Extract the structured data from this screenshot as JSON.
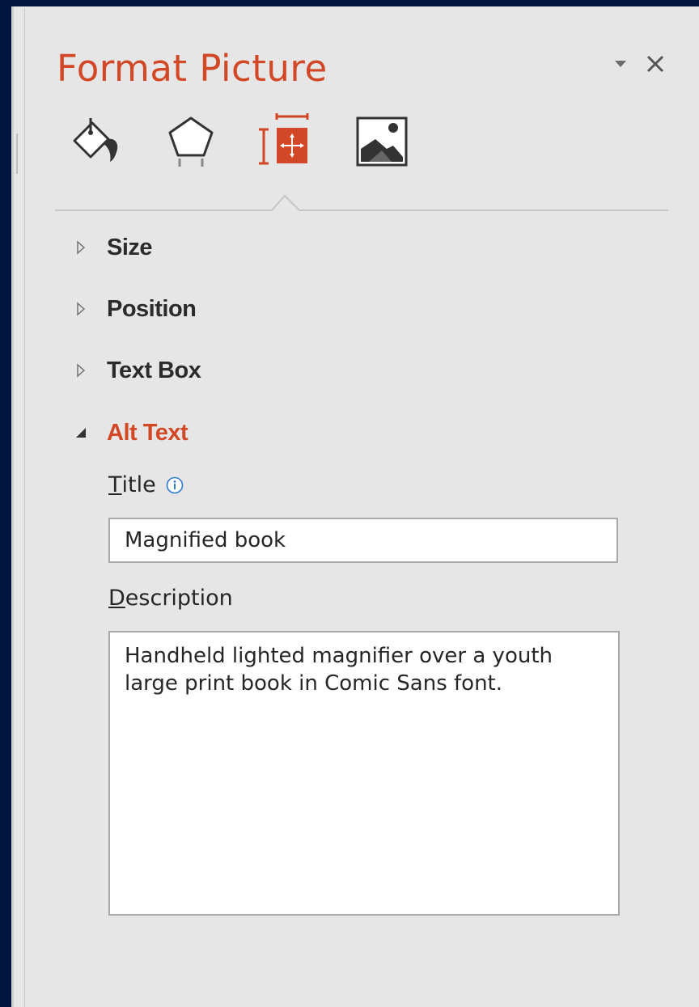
{
  "pane": {
    "title": "Format Picture",
    "accent_color": "#d24726",
    "header_buttons": {
      "dropdown_icon": "chevron-down-icon",
      "close_icon": "close-icon"
    },
    "tabs": [
      {
        "icon": "fill-line-icon",
        "selected": false
      },
      {
        "icon": "effects-icon",
        "selected": false
      },
      {
        "icon": "size-properties-icon",
        "selected": true
      },
      {
        "icon": "picture-icon",
        "selected": false
      }
    ]
  },
  "sections": [
    {
      "label": "Size",
      "expanded": false
    },
    {
      "label": "Position",
      "expanded": false
    },
    {
      "label": "Text Box",
      "expanded": false
    },
    {
      "label": "Alt Text",
      "expanded": true
    }
  ],
  "alt_text": {
    "title_label_first": "T",
    "title_label_rest": "itle",
    "title_value": "Magnified book",
    "description_label_first": "D",
    "description_label_rest": "escription",
    "description_value": "Handheld lighted magnifier over a youth large print book in Comic Sans font."
  }
}
